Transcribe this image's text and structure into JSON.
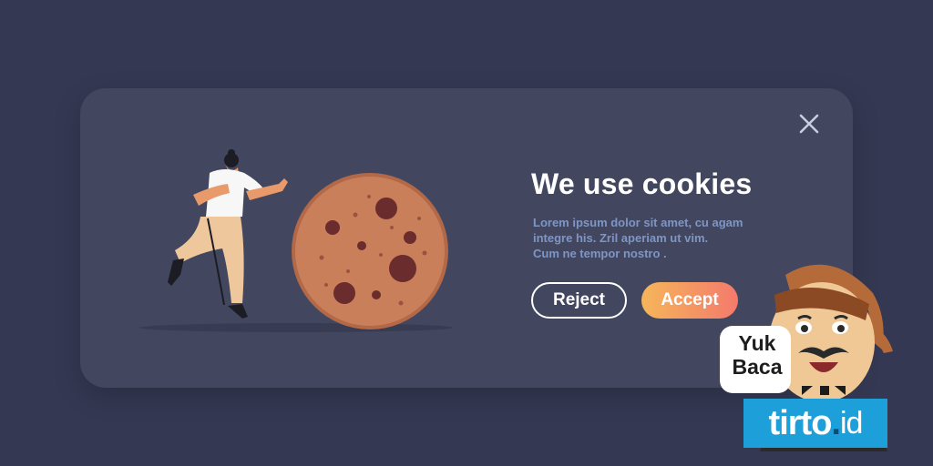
{
  "dialog": {
    "title": "We use cookies",
    "body_lines": [
      "Lorem ipsum dolor sit amet, cu agam",
      "integre his. Zril aperiam ut vim.",
      "Cum ne tempor nostro ."
    ],
    "reject_label": "Reject",
    "accept_label": "Accept",
    "close_icon": "close-icon"
  },
  "overlay": {
    "speech_line1": "Yuk",
    "speech_line2": "Baca",
    "logo_main": "tirto",
    "logo_dot": ".",
    "logo_suffix": "id"
  },
  "colors": {
    "background": "#343852",
    "card": "#42475f",
    "body_text": "#7f95c4",
    "accept_gradient_start": "#f5b65a",
    "accept_gradient_end": "#f47a6c",
    "logo_bg": "#1da0d9"
  }
}
